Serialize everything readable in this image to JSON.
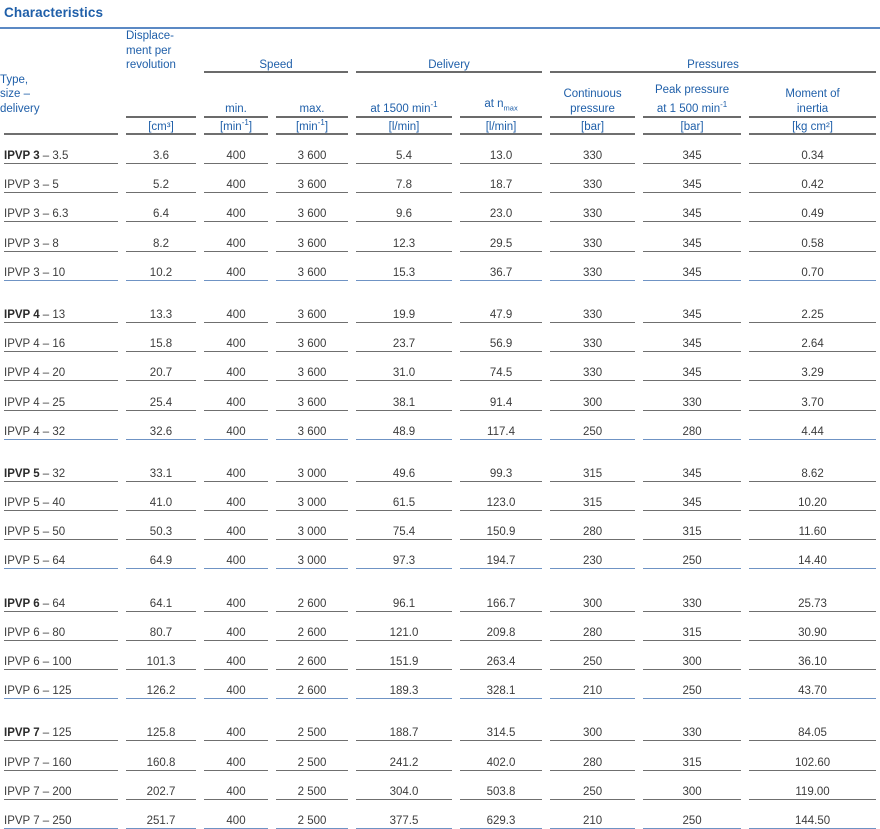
{
  "title": "Characteristics",
  "header": {
    "type_label_lines": [
      "Type,",
      "size –",
      "delivery"
    ],
    "displacement_lines": [
      "Displace-",
      "ment per",
      "revolution"
    ],
    "groups": {
      "speed": "Speed",
      "delivery": "Delivery",
      "pressures": "Pressures"
    },
    "sub": {
      "speed_min": "min.",
      "speed_max": "max.",
      "delivery_1500": "at 1500 min",
      "delivery_1500_sup": "-1",
      "delivery_nmax_pre": "at n",
      "delivery_nmax_sub": "max",
      "continuous_pressure_lines": [
        "Continuous",
        "pressure"
      ],
      "peak_pressure_lines": [
        "Peak pressure",
        "at 1 500 min"
      ],
      "peak_pressure_sup": "-1",
      "moment_of_inertia_lines": [
        "Moment of",
        "inertia"
      ]
    },
    "units": {
      "displacement": "[cm³]",
      "speed_min": "[min",
      "speed_min_sup": "-1",
      "speed_min_end": "]",
      "speed_max": "[min",
      "speed_max_sup": "-1",
      "speed_max_end": "]",
      "delivery_1500": "[l/min]",
      "delivery_nmax": "[l/min]",
      "continuous_pressure": "[bar]",
      "peak_pressure": "[bar]",
      "moment_of_inertia": "[kg cm²]"
    }
  },
  "colors": {
    "brand_blue": "#1f5fa9",
    "rule_blue": "#5b89c4",
    "rule_gray": "#6f6f6f",
    "text": "#3c3c3c"
  },
  "columns": [
    "Type, size – delivery",
    "Displacement per revolution",
    "Speed min.",
    "Speed max.",
    "Delivery at 1500 min-1",
    "Delivery at n max",
    "Continuous pressure",
    "Peak pressure at 1 500 min-1",
    "Moment of inertia"
  ],
  "groups": [
    {
      "name": "IPVP 3",
      "rows": [
        {
          "type_bold": "IPVP 3",
          "type_rest": " – 3.5",
          "displacement": "3.6",
          "speed_min": "400",
          "speed_max": "3 600",
          "delivery_1500": "5.4",
          "delivery_nmax": "13.0",
          "continuous_pressure": "330",
          "peak_pressure": "345",
          "moment_of_inertia": "0.34"
        },
        {
          "type_bold": "",
          "type_rest": "IPVP 3 – 5",
          "displacement": "5.2",
          "speed_min": "400",
          "speed_max": "3 600",
          "delivery_1500": "7.8",
          "delivery_nmax": "18.7",
          "continuous_pressure": "330",
          "peak_pressure": "345",
          "moment_of_inertia": "0.42"
        },
        {
          "type_bold": "",
          "type_rest": "IPVP 3 – 6.3",
          "displacement": "6.4",
          "speed_min": "400",
          "speed_max": "3 600",
          "delivery_1500": "9.6",
          "delivery_nmax": "23.0",
          "continuous_pressure": "330",
          "peak_pressure": "345",
          "moment_of_inertia": "0.49"
        },
        {
          "type_bold": "",
          "type_rest": "IPVP 3 – 8",
          "displacement": "8.2",
          "speed_min": "400",
          "speed_max": "3 600",
          "delivery_1500": "12.3",
          "delivery_nmax": "29.5",
          "continuous_pressure": "330",
          "peak_pressure": "345",
          "moment_of_inertia": "0.58"
        },
        {
          "type_bold": "",
          "type_rest": "IPVP 3 – 10",
          "displacement": "10.2",
          "speed_min": "400",
          "speed_max": "3 600",
          "delivery_1500": "15.3",
          "delivery_nmax": "36.7",
          "continuous_pressure": "330",
          "peak_pressure": "345",
          "moment_of_inertia": "0.70"
        }
      ]
    },
    {
      "name": "IPVP 4",
      "rows": [
        {
          "type_bold": "IPVP 4",
          "type_rest": " – 13",
          "displacement": "13.3",
          "speed_min": "400",
          "speed_max": "3 600",
          "delivery_1500": "19.9",
          "delivery_nmax": "47.9",
          "continuous_pressure": "330",
          "peak_pressure": "345",
          "moment_of_inertia": "2.25"
        },
        {
          "type_bold": "",
          "type_rest": "IPVP 4 – 16",
          "displacement": "15.8",
          "speed_min": "400",
          "speed_max": "3 600",
          "delivery_1500": "23.7",
          "delivery_nmax": "56.9",
          "continuous_pressure": "330",
          "peak_pressure": "345",
          "moment_of_inertia": "2.64"
        },
        {
          "type_bold": "",
          "type_rest": "IPVP 4 – 20",
          "displacement": "20.7",
          "speed_min": "400",
          "speed_max": "3 600",
          "delivery_1500": "31.0",
          "delivery_nmax": "74.5",
          "continuous_pressure": "330",
          "peak_pressure": "345",
          "moment_of_inertia": "3.29"
        },
        {
          "type_bold": "",
          "type_rest": "IPVP 4 – 25",
          "displacement": "25.4",
          "speed_min": "400",
          "speed_max": "3 600",
          "delivery_1500": "38.1",
          "delivery_nmax": "91.4",
          "continuous_pressure": "300",
          "peak_pressure": "330",
          "moment_of_inertia": "3.70"
        },
        {
          "type_bold": "",
          "type_rest": "IPVP 4 – 32",
          "displacement": "32.6",
          "speed_min": "400",
          "speed_max": "3 600",
          "delivery_1500": "48.9",
          "delivery_nmax": "117.4",
          "continuous_pressure": "250",
          "peak_pressure": "280",
          "moment_of_inertia": "4.44"
        }
      ]
    },
    {
      "name": "IPVP 5",
      "rows": [
        {
          "type_bold": "IPVP 5",
          "type_rest": " – 32",
          "displacement": "33.1",
          "speed_min": "400",
          "speed_max": "3 000",
          "delivery_1500": "49.6",
          "delivery_nmax": "99.3",
          "continuous_pressure": "315",
          "peak_pressure": "345",
          "moment_of_inertia": "8.62"
        },
        {
          "type_bold": "",
          "type_rest": "IPVP 5 – 40",
          "displacement": "41.0",
          "speed_min": "400",
          "speed_max": "3 000",
          "delivery_1500": "61.5",
          "delivery_nmax": "123.0",
          "continuous_pressure": "315",
          "peak_pressure": "345",
          "moment_of_inertia": "10.20"
        },
        {
          "type_bold": "",
          "type_rest": "IPVP 5 – 50",
          "displacement": "50.3",
          "speed_min": "400",
          "speed_max": "3 000",
          "delivery_1500": "75.4",
          "delivery_nmax": "150.9",
          "continuous_pressure": "280",
          "peak_pressure": "315",
          "moment_of_inertia": "11.60"
        },
        {
          "type_bold": "",
          "type_rest": "IPVP 5 – 64",
          "displacement": "64.9",
          "speed_min": "400",
          "speed_max": "3 000",
          "delivery_1500": "97.3",
          "delivery_nmax": "194.7",
          "continuous_pressure": "230",
          "peak_pressure": "250",
          "moment_of_inertia": "14.40"
        }
      ]
    },
    {
      "name": "IPVP 6",
      "rows": [
        {
          "type_bold": "IPVP 6",
          "type_rest": " – 64",
          "displacement": "64.1",
          "speed_min": "400",
          "speed_max": "2 600",
          "delivery_1500": "96.1",
          "delivery_nmax": "166.7",
          "continuous_pressure": "300",
          "peak_pressure": "330",
          "moment_of_inertia": "25.73"
        },
        {
          "type_bold": "",
          "type_rest": "IPVP 6 – 80",
          "displacement": "80.7",
          "speed_min": "400",
          "speed_max": "2 600",
          "delivery_1500": "121.0",
          "delivery_nmax": "209.8",
          "continuous_pressure": "280",
          "peak_pressure": "315",
          "moment_of_inertia": "30.90"
        },
        {
          "type_bold": "",
          "type_rest": "IPVP 6 – 100",
          "displacement": "101.3",
          "speed_min": "400",
          "speed_max": "2 600",
          "delivery_1500": "151.9",
          "delivery_nmax": "263.4",
          "continuous_pressure": "250",
          "peak_pressure": "300",
          "moment_of_inertia": "36.10"
        },
        {
          "type_bold": "",
          "type_rest": "IPVP 6 – 125",
          "displacement": "126.2",
          "speed_min": "400",
          "speed_max": "2 600",
          "delivery_1500": "189.3",
          "delivery_nmax": "328.1",
          "continuous_pressure": "210",
          "peak_pressure": "250",
          "moment_of_inertia": "43.70"
        }
      ]
    },
    {
      "name": "IPVP 7",
      "rows": [
        {
          "type_bold": "IPVP 7",
          "type_rest": " – 125",
          "displacement": "125.8",
          "speed_min": "400",
          "speed_max": "2 500",
          "delivery_1500": "188.7",
          "delivery_nmax": "314.5",
          "continuous_pressure": "300",
          "peak_pressure": "330",
          "moment_of_inertia": "84.05"
        },
        {
          "type_bold": "",
          "type_rest": "IPVP 7 – 160",
          "displacement": "160.8",
          "speed_min": "400",
          "speed_max": "2 500",
          "delivery_1500": "241.2",
          "delivery_nmax": "402.0",
          "continuous_pressure": "280",
          "peak_pressure": "315",
          "moment_of_inertia": "102.60"
        },
        {
          "type_bold": "",
          "type_rest": "IPVP 7 – 200",
          "displacement": "202.7",
          "speed_min": "400",
          "speed_max": "2 500",
          "delivery_1500": "304.0",
          "delivery_nmax": "503.8",
          "continuous_pressure": "250",
          "peak_pressure": "300",
          "moment_of_inertia": "119.00"
        },
        {
          "type_bold": "",
          "type_rest": "IPVP 7 – 250",
          "displacement": "251.7",
          "speed_min": "400",
          "speed_max": "2 500",
          "delivery_1500": "377.5",
          "delivery_nmax": "629.3",
          "continuous_pressure": "210",
          "peak_pressure": "250",
          "moment_of_inertia": "144.50"
        }
      ]
    }
  ]
}
